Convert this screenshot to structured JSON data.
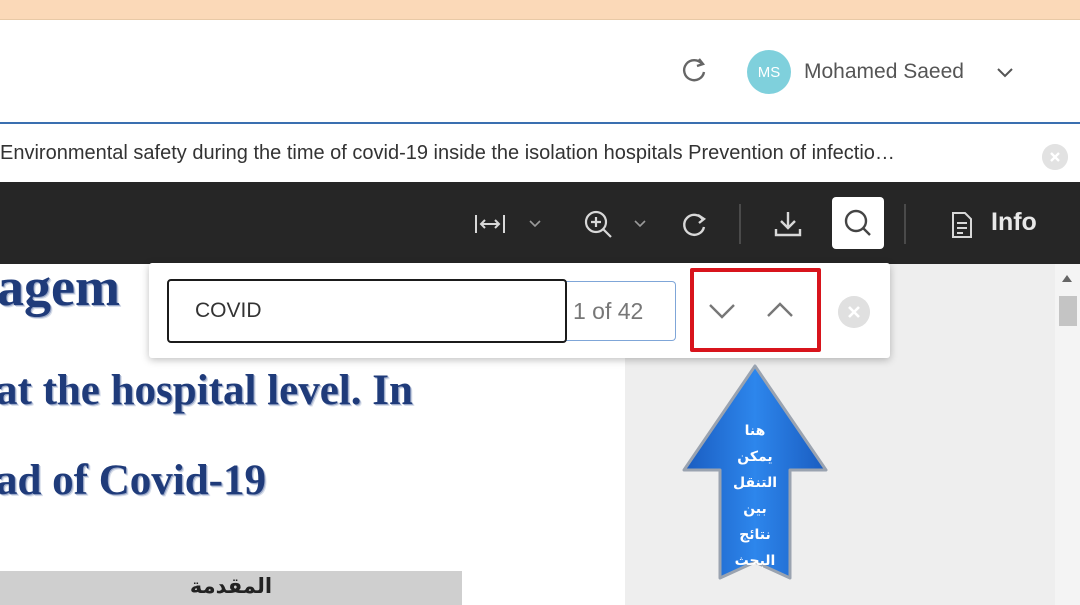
{
  "header": {
    "user_initials": "MS",
    "user_name": "Mohamed Saeed"
  },
  "document": {
    "title": "Environmental safety during the time of covid-19 inside the isolation hospitals Prevention of infectio…",
    "lines": [
      "agem",
      "at the hospital level. In",
      "ad of Covid-19"
    ],
    "section_heading": "المقدمة"
  },
  "toolbar": {
    "info_label": "Info",
    "icons": [
      "fit-width-icon",
      "zoom-in-icon",
      "rotate-icon",
      "download-icon",
      "search-icon",
      "info-document-icon"
    ]
  },
  "find": {
    "query": "COVID",
    "result_count": "1 of 42"
  },
  "annotation": {
    "lines": [
      "هنا",
      "يمكن",
      "التنقل",
      "بين",
      "نتائج",
      "البحث"
    ]
  },
  "colors": {
    "accent_border": "#3a6fb0",
    "toolbar_bg": "#262626",
    "highlight": "#d8141c",
    "callout_fill": "#1f6fd6",
    "avatar": "#7fd0dc"
  }
}
